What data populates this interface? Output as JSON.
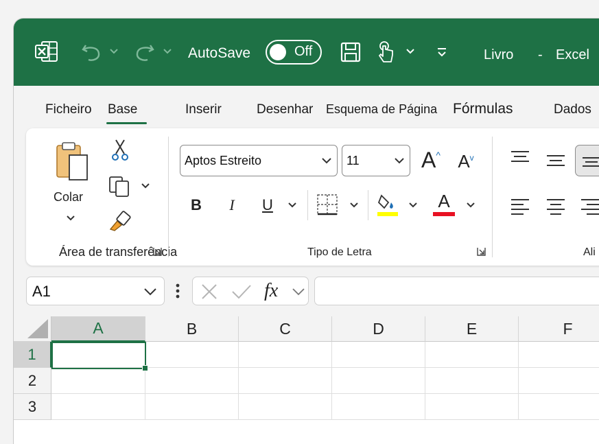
{
  "titlebar": {
    "autosave_label": "AutoSave",
    "autosave_state": "Off",
    "doc_name": "Livro",
    "separator": "-",
    "app_name": "Excel",
    "bg_color": "#1e7145"
  },
  "tabs": [
    {
      "label": "Ficheiro",
      "active": false
    },
    {
      "label": "Base",
      "active": true
    },
    {
      "label": "Inserir",
      "active": false
    },
    {
      "label": "Desenhar",
      "active": false
    },
    {
      "label": "Esquema de Página",
      "active": false
    },
    {
      "label": "Fórmulas",
      "active": false
    },
    {
      "label": "Dados",
      "active": false
    }
  ],
  "ribbon": {
    "clipboard": {
      "paste_label": "Colar",
      "group_label": "Área de transferência"
    },
    "font": {
      "font_name": "Aptos Estreito",
      "font_size": "11",
      "group_label": "Tipo de Letra",
      "bold": "B",
      "italic": "I",
      "underline": "U",
      "grow_glyph": "A",
      "shrink_glyph": "A",
      "font_color_glyph": "A",
      "highlight_color": "#ffff00",
      "font_color": "#e81123"
    },
    "alignment": {
      "group_label": "Ali"
    }
  },
  "formula_bar": {
    "name_box": "A1",
    "fx_label": "fx",
    "formula": ""
  },
  "grid": {
    "columns": [
      "A",
      "B",
      "C",
      "D",
      "E",
      "F"
    ],
    "rows": [
      "1",
      "2",
      "3"
    ],
    "active_cell": "A1"
  }
}
